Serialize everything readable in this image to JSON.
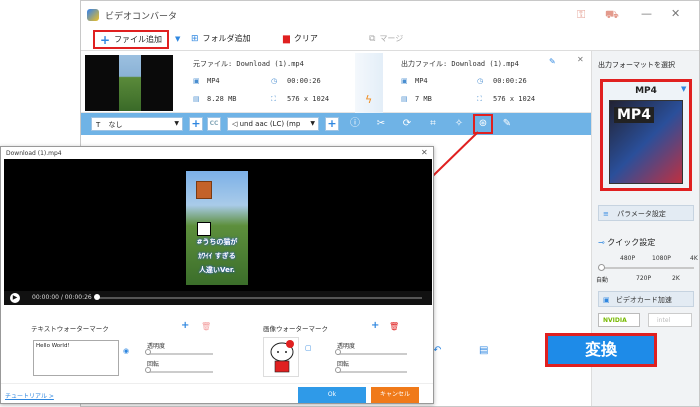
{
  "app": {
    "title": "ビデオコンバータ"
  },
  "toolbar": {
    "add_file": "ファイル追加",
    "add_folder": "フォルダ追加",
    "clear": "クリア",
    "merge": "マージ"
  },
  "file": {
    "source_name": "元ファイル: Download (1).mp4",
    "output_name": "出力ファイル: Download (1).mp4",
    "src_format": "MP4",
    "src_duration": "00:00:26",
    "src_size": "8.28 MB",
    "src_res": "576 x 1024",
    "out_format": "MP4",
    "out_duration": "00:00:26",
    "out_size": "7 MB",
    "out_res": "576 x 1024"
  },
  "edit_bar": {
    "subtitle": "なし",
    "audio": "und aac (LC) (mp"
  },
  "right_panel": {
    "title": "出力フォーマットを選択",
    "format": "MP4",
    "param_button": "パラメータ設定",
    "quick_title": "クイック設定",
    "quick_marks": [
      "480P",
      "1080P",
      "4K"
    ],
    "quick_marks2": [
      "自動",
      "720P",
      "2K"
    ],
    "gpu": "ビデオカード加速",
    "nvidia": "NVIDIA",
    "intel": "intel"
  },
  "convert": "変換",
  "editor": {
    "title": "Download (1).mp4",
    "time": "00:00:00 / 00:00:26",
    "overlay_lines": [
      "#うちの猫が",
      "ｶﾜｲｲ すぎる",
      "人違いVer."
    ],
    "text_wm_label": "テキストウォーターマーク",
    "image_wm_label": "画像ウォーターマーク",
    "wm_text": "Hello World!",
    "opacity": "透明度",
    "rotate": "回転",
    "tutorial": "チュートリアル >",
    "ok": "Ok",
    "cancel": "キャンセル"
  }
}
